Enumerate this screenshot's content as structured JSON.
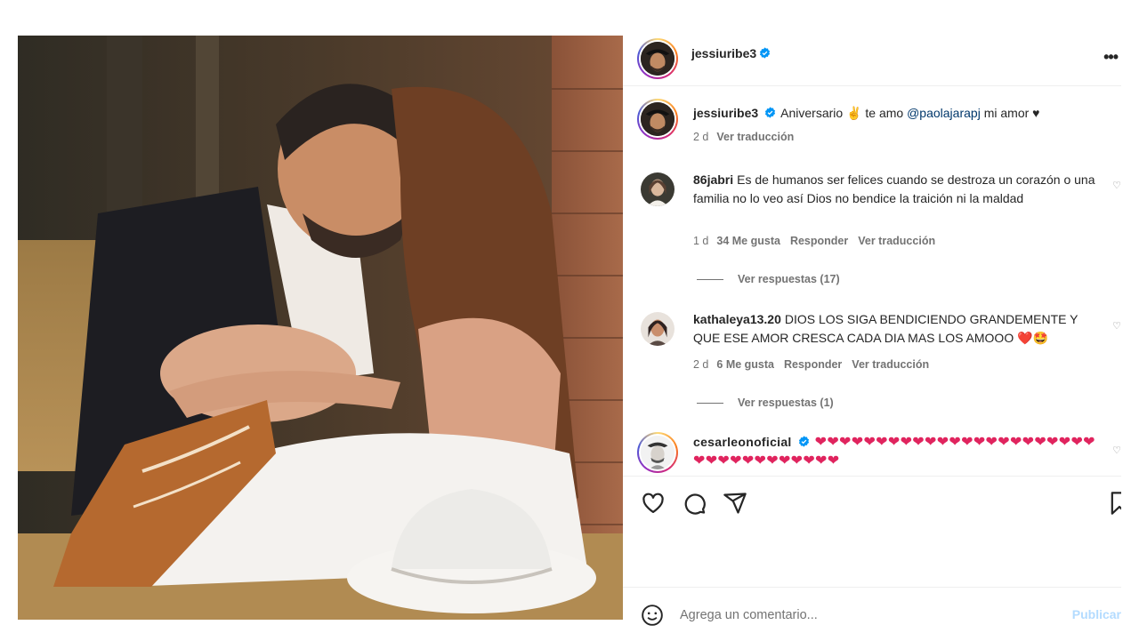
{
  "post": {
    "author": "jessiuribe3",
    "more_label": "•••"
  },
  "caption": {
    "username": "jessiuribe3",
    "text_before": "Aniversario ✌ te amo ",
    "mention": "@paolajarapj",
    "text_after": " mi amor ♥",
    "time": "2 d",
    "translate": "Ver traducción"
  },
  "comments": [
    {
      "username": "86jabri",
      "text": "Es de humanos ser felices cuando se destroza un corazón o una familia no lo veo así Dios no bendice la traición ni la maldad",
      "time": "1 d",
      "likes": "34 Me gusta",
      "reply": "Responder",
      "translate": "Ver traducción",
      "replies": "Ver respuestas (17)"
    },
    {
      "username": "kathaleya13.20",
      "text": "DIOS LOS SIGA BENDICIENDO GRANDEMENTE Y QUE ESE AMOR CRESCA CADA DIA MAS LOS AMOOO ❤️🤩",
      "time": "2 d",
      "likes": "6 Me gusta",
      "reply": "Responder",
      "translate": "Ver traducción",
      "replies": "Ver respuestas (1)"
    },
    {
      "username": "cesarleonoficial",
      "text": "❤❤❤❤❤❤❤❤❤❤❤❤❤❤❤❤❤❤❤❤❤❤❤❤❤❤❤❤❤❤❤❤❤❤❤"
    }
  ],
  "actions": {
    "like_icon": "heart-icon",
    "comment_icon": "comment-icon",
    "share_icon": "share-icon",
    "save_icon": "bookmark-icon"
  },
  "add_comment": {
    "placeholder": "Agrega un comentario...",
    "publish": "Publicar"
  },
  "colors": {
    "verified": "#0095f6",
    "heart": "#e0245e",
    "mention": "#00376b",
    "publish_disabled": "#b3dbff"
  }
}
